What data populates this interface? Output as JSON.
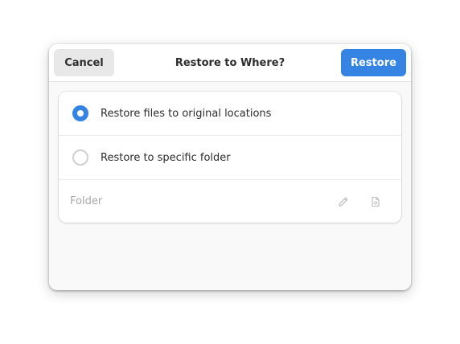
{
  "dialog": {
    "title": "Restore to Where?",
    "cancel_label": "Cancel",
    "restore_label": "Restore"
  },
  "options": {
    "original": {
      "label": "Restore files to original locations",
      "selected": true
    },
    "specific": {
      "label": "Restore to specific folder",
      "selected": false
    }
  },
  "folder": {
    "label": "Folder",
    "edit_icon": "pencil-icon",
    "choose_icon": "document-icon"
  },
  "colors": {
    "accent": "#3584e4",
    "cancel_bg": "#e8e8e8",
    "dim_text": "#a8a8a8"
  }
}
